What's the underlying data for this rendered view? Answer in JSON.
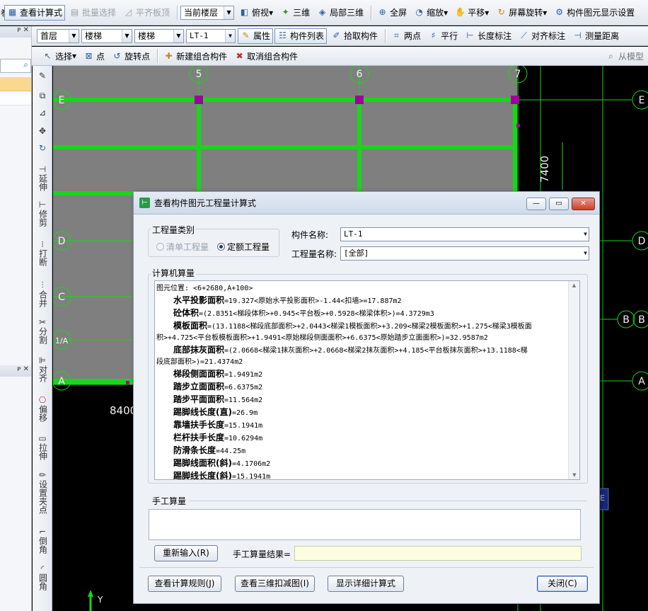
{
  "toolbar1": {
    "view_formula": "查看计算式",
    "batch_select": "批量选择",
    "align_slab": "平齐板顶",
    "current_floor": "当前楼层",
    "top_view": "俯视",
    "three_d": "三维",
    "local_3d": "局部三维",
    "full_screen": "全屏",
    "zoom": "缩放",
    "pan": "平移",
    "screen_rotate": "屏幕旋转",
    "display_settings": "构件图元显示设置"
  },
  "toolbar2": {
    "floor": "首层",
    "category": "楼梯",
    "type": "楼梯",
    "component": "LT-1",
    "properties": "属性",
    "component_list": "构件列表",
    "pick_component": "拾取构件",
    "two_points": "两点",
    "parallel": "平行",
    "length_dim": "长度标注",
    "align_dim": "对齐标注",
    "measure": "测量距离"
  },
  "toolbar3": {
    "select": "选择",
    "point": "点",
    "rotate_point": "旋转点",
    "new_group": "新建组合构件",
    "cancel_group": "取消组合构件",
    "from_model": "从模型"
  },
  "vertical_tools": [
    "延伸",
    "修剪",
    "打断",
    "合并",
    "分割",
    "对齐",
    "偏移",
    "拉伸",
    "设置夹点",
    "倒角",
    "圆角"
  ],
  "cad": {
    "grid_top": [
      "5",
      "6",
      "7"
    ],
    "grid_left": [
      "E",
      "D",
      "C",
      "1/A",
      "A"
    ],
    "grid_right": [
      "E",
      "D",
      "B",
      "B",
      "A"
    ],
    "dim_vertical": "7400",
    "dim_horizontal": "8400",
    "axis_y": "Y",
    "grid_color": "#19d61a",
    "slab_color": "#7f7f7f",
    "node_color": "#a000a0"
  },
  "dialog": {
    "title": "查看构件图元工程量计算式",
    "qty_type_label": "工程量类别",
    "radio_list": "清单工程量",
    "radio_quota": "定额工程量",
    "component_name_label": "构件名称:",
    "component_name_value": "LT-1",
    "qty_name_label": "工程量名称:",
    "qty_name_value": "[全部]",
    "computer_calc_label": "计算机算量",
    "lines": [
      {
        "label": "",
        "text": "图元位置: <6+2680,A+100>",
        "indent": false
      },
      {
        "label": "水平投影面积",
        "text": "=19.327<原始水平投影面积>-1.44<扣墙>=17.887m2",
        "indent": true
      },
      {
        "label": "砼体积",
        "text": "=(2.8351<梯段体积>+0.945<平台板>+0.5928<梯梁体积>)=4.3729m3",
        "indent": true
      },
      {
        "label": "模板面积",
        "text": "=(13.1188<梯段底部面积>+2.0443<梯梁1模板面积>+3.209<梯梁2模板面积>+1.275<梯梁3模板面",
        "indent": true
      },
      {
        "label": "",
        "text": "积>+4.725<平台板模板面积>+1.9491<原始梯段侧面面积>+6.6375<原始踏步立面面积>)=32.9587m2",
        "indent": false
      },
      {
        "label": "底部抹灰面积",
        "text": "=(2.0668<梯梁1抹灰面积>+2.0668<梯梁2抹灰面积>+4.185<平台板抹灰面积>+13.1188<梯",
        "indent": true
      },
      {
        "label": "",
        "text": "段底部面积>)=21.4374m2",
        "indent": false
      },
      {
        "label": "梯段侧面面积",
        "text": "=1.9491m2",
        "indent": true
      },
      {
        "label": "踏步立面面积",
        "text": "=6.6375m2",
        "indent": true
      },
      {
        "label": "踏步平面面积",
        "text": "=11.564m2",
        "indent": true
      },
      {
        "label": "踢脚线长度(直)",
        "text": "=26.9m",
        "indent": true
      },
      {
        "label": "靠墙扶手长度",
        "text": "=15.1941m",
        "indent": true
      },
      {
        "label": "栏杆扶手长度",
        "text": "=10.6294m",
        "indent": true
      },
      {
        "label": "防滑条长度",
        "text": "=44.25m",
        "indent": true
      },
      {
        "label": "踢脚线面积(斜)",
        "text": "=4.1706m2",
        "indent": true
      },
      {
        "label": "踢脚线长度(斜)",
        "text": "=15.1941m",
        "indent": true
      }
    ],
    "manual_label": "手工算量",
    "reinput_btn": "重新输入(R)",
    "manual_result_label": "手工算量结果=",
    "btn_rules": "查看计算规则(J)",
    "btn_3d": "查看三维扣减图(I)",
    "btn_detail": "显示详细计算式",
    "btn_close": "关闭(C)"
  }
}
